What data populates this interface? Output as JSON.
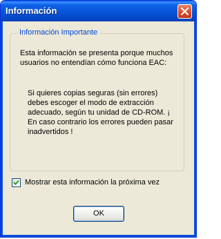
{
  "window": {
    "title": "Información",
    "close_icon": "close-icon"
  },
  "group": {
    "legend": "Información Importante",
    "intro_text": "Esta información se presenta porque muchos usuarios no entendían cómo funciona EAC:",
    "detail_text": "Si quieres copias seguras (sin errores) debes escoger el modo de extracción adecuado, según tu unidad de CD-ROM. ¡ En caso contrario los errores pueden pasar inadvertidos !"
  },
  "checkbox": {
    "label": "Mostrar esta información la próxima vez",
    "checked": true
  },
  "buttons": {
    "ok_label": "OK"
  },
  "colors": {
    "titlebar": "#0754d8",
    "legend": "#0046d5",
    "dialog_bg": "#ece9d8",
    "close_button": "#d9532f",
    "checkmark": "#21a121"
  }
}
